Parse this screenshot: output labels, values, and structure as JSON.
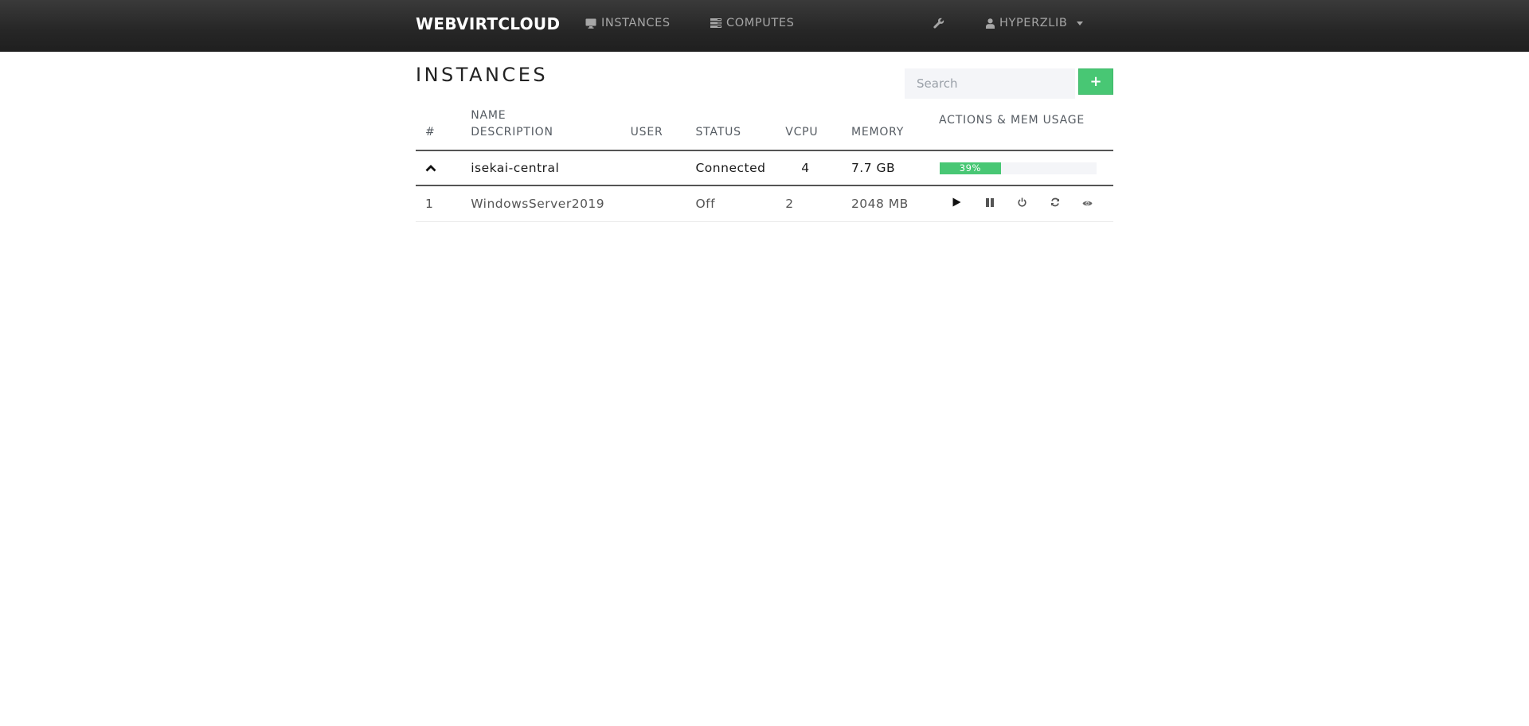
{
  "navbar": {
    "brand": "WEBVIRTCLOUD",
    "links": [
      {
        "label": "INSTANCES",
        "icon": "desktop-icon"
      },
      {
        "label": "COMPUTES",
        "icon": "server-icon"
      }
    ],
    "settings_icon": "wrench-icon",
    "user": {
      "label": "HYPERZLIB",
      "icon": "user-icon"
    }
  },
  "page": {
    "title": "INSTANCES",
    "search_placeholder": "Search",
    "add_label": "+"
  },
  "table": {
    "headers": {
      "num": "#",
      "name": "NAME",
      "description": "DESCRIPTION",
      "user": "USER",
      "status": "STATUS",
      "vcpu": "VCPU",
      "memory": "MEMORY",
      "actions": "ACTIONS & MEM USAGE"
    },
    "host": {
      "toggle_icon": "chevron-up-icon",
      "name": "isekai-central",
      "status": "Connected",
      "vcpu": "4",
      "memory": "7.7 GB",
      "mem_usage_percent": 39,
      "mem_usage_label": "39%",
      "status_color": "#48c774"
    },
    "instances": [
      {
        "num": "1",
        "name": "WindowsServer2019",
        "user": "",
        "status": "Off",
        "status_color": "#e05454",
        "vcpu": "2",
        "memory": "2048 MB",
        "actions": [
          "play-icon",
          "pause-icon",
          "power-icon",
          "refresh-icon",
          "eye-icon"
        ]
      }
    ]
  }
}
